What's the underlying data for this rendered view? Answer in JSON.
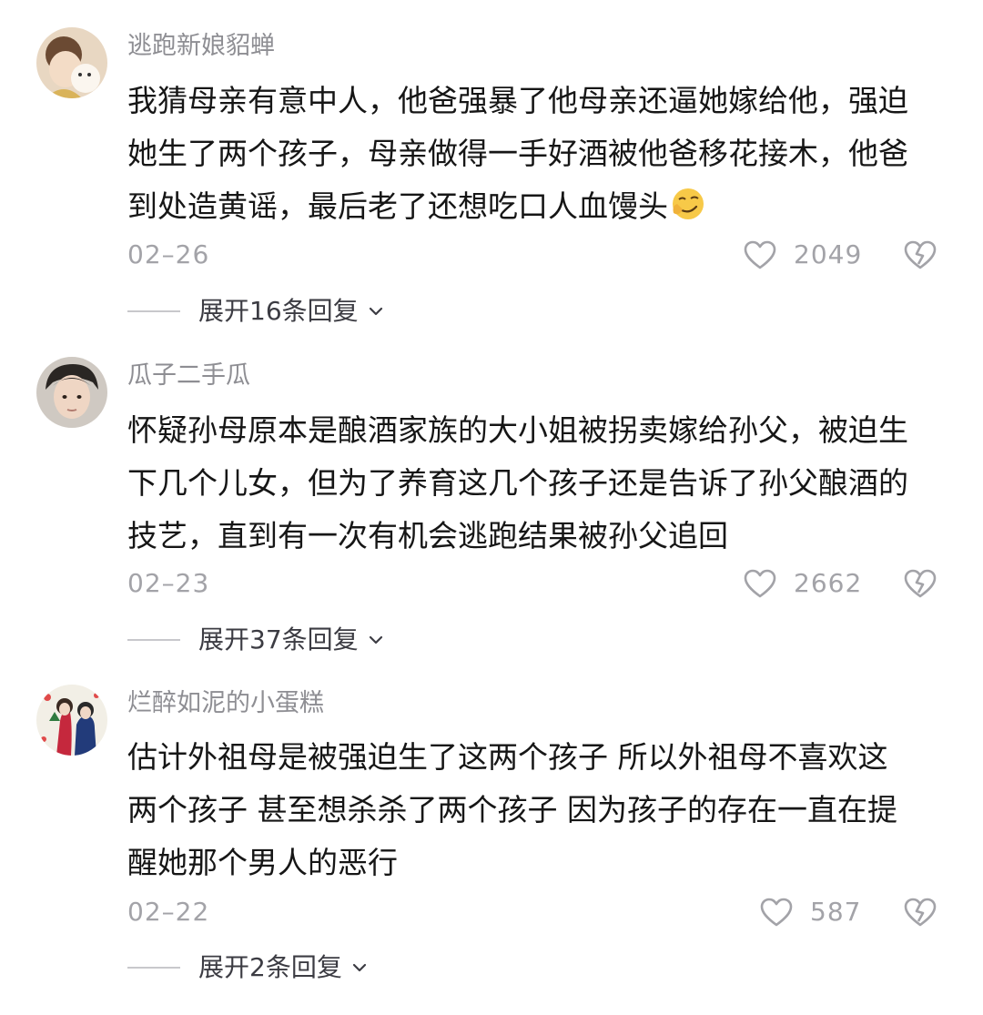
{
  "comments": [
    {
      "username": "逃跑新娘貂蝉",
      "lines": [
        "我猜母亲有意中人，他爸强暴了他母亲还逼她嫁给他，强迫",
        "她生了两个孩子，母亲做得一手好酒被他爸移花接木，他爸",
        "到处造黄谣，最后老了还想吃口人血馒头"
      ],
      "emoji": "smirk-face-emoji",
      "date": "02–26",
      "likes": "2049",
      "expand": "展开16条回复"
    },
    {
      "username": "瓜子二手瓜",
      "lines": [
        "怀疑孙母原本是酿酒家族的大小姐被拐卖嫁给孙父，被迫生",
        "下几个儿女，但为了养育这几个孩子还是告诉了孙父酿酒的",
        "技艺，直到有一次有机会逃跑结果被孙父追回"
      ],
      "date": "02–23",
      "likes": "2662",
      "expand": "展开37条回复"
    },
    {
      "username": "烂醉如泥的小蛋糕",
      "lines": [
        "估计外祖母是被强迫生了这两个孩子 所以外祖母不喜欢这",
        "两个孩子 甚至想杀杀了两个孩子 因为孩子的存在一直在提",
        "醒她那个男人的恶行"
      ],
      "date": "02–22",
      "likes": "587",
      "expand": "展开2条回复"
    }
  ],
  "icons": {
    "like": "heart-outline-icon",
    "dislike": "broken-heart-outline-icon",
    "expand": "chevron-down-icon"
  },
  "colors": {
    "username": "#8e8e93",
    "body": "#161616",
    "meta": "#a3a3a8",
    "expand": "#3c3c43"
  }
}
